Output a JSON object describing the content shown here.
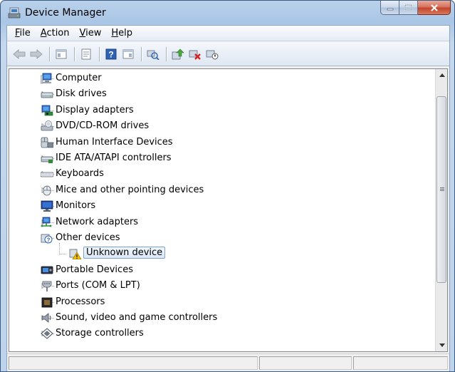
{
  "window": {
    "title": "Device Manager"
  },
  "menu": [
    {
      "label": "File",
      "accel": "F",
      "rest": "ile"
    },
    {
      "label": "Action",
      "accel": "A",
      "rest": "ction"
    },
    {
      "label": "View",
      "accel": "V",
      "rest": "iew"
    },
    {
      "label": "Help",
      "accel": "H",
      "rest": "elp"
    }
  ],
  "toolbar": {
    "buttons": [
      "back-arrow-icon",
      "forward-arrow-icon",
      "show-hide-console-tree-icon",
      "properties-icon",
      "help-icon",
      "show-action-pane-icon",
      "scan-hardware-icon",
      "update-driver-icon",
      "uninstall-icon",
      "disable-device-icon"
    ]
  },
  "tree": {
    "items": [
      {
        "label": "Computer",
        "icon": "computer-icon",
        "expanded": false
      },
      {
        "label": "Disk drives",
        "icon": "disk-drive-icon",
        "expanded": false
      },
      {
        "label": "Display adapters",
        "icon": "display-adapter-icon",
        "expanded": false
      },
      {
        "label": "DVD/CD-ROM drives",
        "icon": "dvd-drive-icon",
        "expanded": false
      },
      {
        "label": "Human Interface Devices",
        "icon": "hid-icon",
        "expanded": false
      },
      {
        "label": "IDE ATA/ATAPI controllers",
        "icon": "ide-controller-icon",
        "expanded": false
      },
      {
        "label": "Keyboards",
        "icon": "keyboard-icon",
        "expanded": false
      },
      {
        "label": "Mice and other pointing devices",
        "icon": "mouse-icon",
        "expanded": false
      },
      {
        "label": "Monitors",
        "icon": "monitor-icon",
        "expanded": false
      },
      {
        "label": "Network adapters",
        "icon": "network-adapter-icon",
        "expanded": false
      },
      {
        "label": "Other devices",
        "icon": "other-devices-icon",
        "expanded": true
      },
      {
        "label": "Unknown device",
        "icon": "unknown-device-warning-icon",
        "child": true,
        "selected": true
      },
      {
        "label": "Portable Devices",
        "icon": "portable-device-icon",
        "expanded": false
      },
      {
        "label": "Ports (COM & LPT)",
        "icon": "port-icon",
        "expanded": false
      },
      {
        "label": "Processors",
        "icon": "processor-icon",
        "expanded": false
      },
      {
        "label": "Sound, video and game controllers",
        "icon": "sound-icon",
        "expanded": false
      },
      {
        "label": "Storage controllers",
        "icon": "storage-controller-icon",
        "expanded": false
      }
    ]
  },
  "colors": {
    "title_bg": "#b9d1ea",
    "selection_border": "#7da2ce",
    "close_button": "#c2452b",
    "warning_yellow": "#f2c200"
  }
}
